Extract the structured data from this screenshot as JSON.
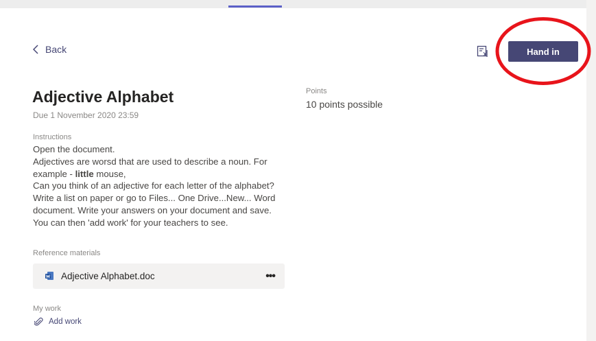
{
  "nav": {
    "back_label": "Back"
  },
  "toolbar": {
    "hand_in_label": "Hand in",
    "immersive_reader_icon": "immersive-reader-icon"
  },
  "assignment": {
    "title": "Adjective Alphabet",
    "due": "Due 1 November 2020 23:59",
    "points_label": "Points",
    "points_value": "10 points possible",
    "instructions_label": "Instructions",
    "instructions": {
      "line1": "Open the document.",
      "line2": "Adjectives are worsd that are used to describe a noun. For",
      "line3_prefix": "example - ",
      "line3_bold": "little",
      "line3_suffix": " mouse,",
      "line4": "Can you think of an adjective for each letter of the alphabet?",
      "line5": "Write a list on paper or go to Files... One Drive...New... Word",
      "line6": "document. Write your answers on your document and save.",
      "line7": "You can then 'add work' for your teachers to see."
    },
    "reference_label": "Reference materials",
    "reference_file": "Adjective Alphabet.doc",
    "more_label": "•••",
    "my_work_label": "My work",
    "add_work_label": "Add work"
  },
  "colors": {
    "accent": "#464775",
    "annotation": "#e8141b",
    "card": "#f3f2f1"
  }
}
